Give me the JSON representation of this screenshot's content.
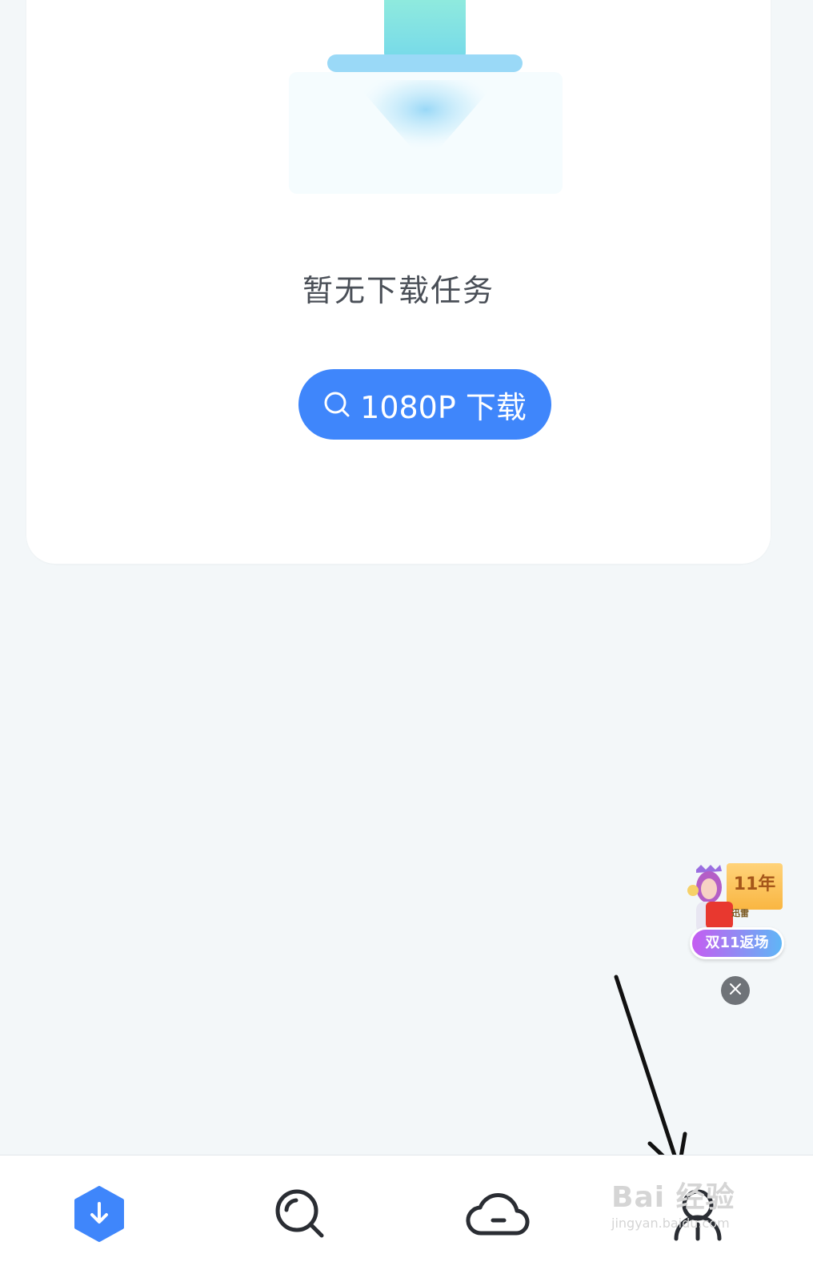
{
  "empty_state": {
    "message": "暂无下载任务",
    "button_label": "1080P 下载",
    "button_icon": "search-icon"
  },
  "promo": {
    "year_badge": "11年",
    "mini_text": "迅雷",
    "label": "双11返场",
    "close_icon": "close-icon"
  },
  "bottom_nav": {
    "items": [
      {
        "name": "downloads",
        "icon": "hexagon-download-icon",
        "active": true
      },
      {
        "name": "discover",
        "icon": "search-icon",
        "active": false
      },
      {
        "name": "cloud",
        "icon": "cloud-icon",
        "active": false
      },
      {
        "name": "profile",
        "icon": "user-icon",
        "active": false
      }
    ]
  },
  "watermark": {
    "main": "Bai 经验",
    "sub": "jingyan.baidu.com"
  },
  "colors": {
    "accent": "#3f86fb",
    "background": "#f3f7f9",
    "text": "#4a4f57"
  }
}
